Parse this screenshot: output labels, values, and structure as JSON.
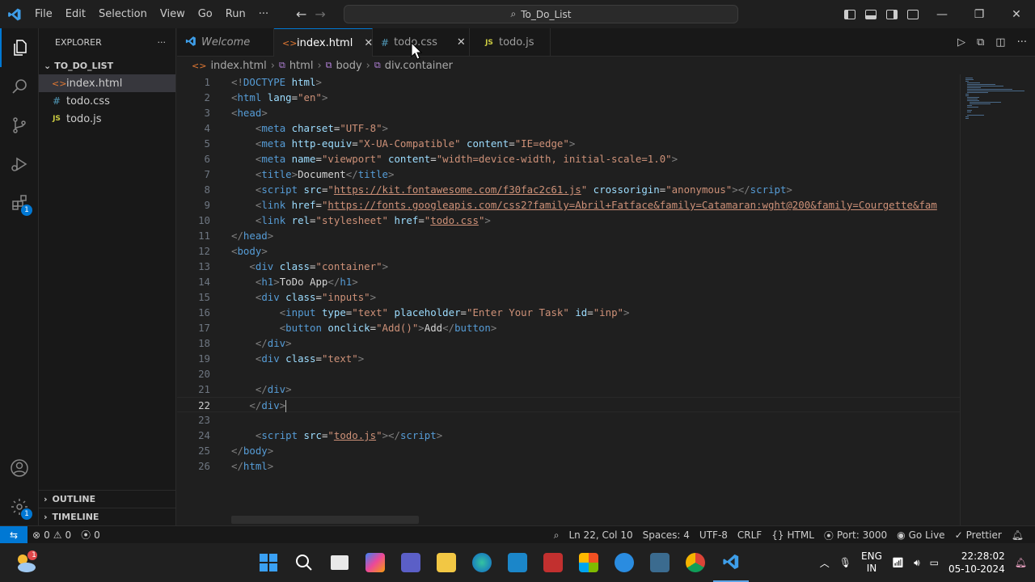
{
  "menu": [
    "File",
    "Edit",
    "Selection",
    "View",
    "Go",
    "Run",
    "···"
  ],
  "command_center": "To_Do_List",
  "explorer": {
    "title": "EXPLORER",
    "more": "···",
    "folder": "TO_DO_LIST",
    "files": [
      {
        "name": "index.html",
        "icon": "<>",
        "type": "html"
      },
      {
        "name": "todo.css",
        "icon": "#",
        "type": "css"
      },
      {
        "name": "todo.js",
        "icon": "JS",
        "type": "js"
      }
    ],
    "outline": "OUTLINE",
    "timeline": "TIMELINE"
  },
  "tabs": [
    {
      "label": "Welcome",
      "icon": "⟩"
    },
    {
      "label": "index.html",
      "icon": "<>"
    },
    {
      "label": "todo.css",
      "icon": "#"
    },
    {
      "label": "todo.js",
      "icon": "JS"
    }
  ],
  "tab_close": "✕",
  "breadcrumb": [
    "index.html",
    "html",
    "body",
    "div.container"
  ],
  "breadcrumb_icons": [
    "<>",
    "⧉",
    "⧉",
    "⧉"
  ],
  "code": {
    "line_numbers": [
      "1",
      "2",
      "3",
      "4",
      "5",
      "6",
      "7",
      "8",
      "9",
      "10",
      "11",
      "12",
      "13",
      "14",
      "15",
      "16",
      "17",
      "18",
      "19",
      "20",
      "21",
      "22",
      "23",
      "24",
      "25",
      "26"
    ],
    "lines": [
      {
        "indent": "",
        "parts": [
          [
            "g",
            "<!"
          ],
          [
            "t",
            "DOCTYPE"
          ],
          [
            "d",
            " "
          ],
          [
            "a",
            "html"
          ],
          [
            "g",
            ">"
          ]
        ]
      },
      {
        "indent": "",
        "parts": [
          [
            "g",
            "<"
          ],
          [
            "t",
            "html"
          ],
          [
            "d",
            " "
          ],
          [
            "a",
            "lang"
          ],
          [
            "d",
            "="
          ],
          [
            "s",
            "\"en\""
          ],
          [
            "g",
            ">"
          ]
        ]
      },
      {
        "indent": "",
        "parts": [
          [
            "g",
            "<"
          ],
          [
            "t",
            "head"
          ],
          [
            "g",
            ">"
          ]
        ]
      },
      {
        "indent": "    ",
        "parts": [
          [
            "g",
            "<"
          ],
          [
            "t",
            "meta"
          ],
          [
            "d",
            " "
          ],
          [
            "a",
            "charset"
          ],
          [
            "d",
            "="
          ],
          [
            "s",
            "\"UTF-8\""
          ],
          [
            "g",
            ">"
          ]
        ]
      },
      {
        "indent": "    ",
        "parts": [
          [
            "g",
            "<"
          ],
          [
            "t",
            "meta"
          ],
          [
            "d",
            " "
          ],
          [
            "a",
            "http-equiv"
          ],
          [
            "d",
            "="
          ],
          [
            "s",
            "\"X-UA-Compatible\""
          ],
          [
            "d",
            " "
          ],
          [
            "a",
            "content"
          ],
          [
            "d",
            "="
          ],
          [
            "s",
            "\"IE=edge\""
          ],
          [
            "g",
            ">"
          ]
        ]
      },
      {
        "indent": "    ",
        "parts": [
          [
            "g",
            "<"
          ],
          [
            "t",
            "meta"
          ],
          [
            "d",
            " "
          ],
          [
            "a",
            "name"
          ],
          [
            "d",
            "="
          ],
          [
            "s",
            "\"viewport\""
          ],
          [
            "d",
            " "
          ],
          [
            "a",
            "content"
          ],
          [
            "d",
            "="
          ],
          [
            "s",
            "\"width=device-width, initial-scale=1.0\""
          ],
          [
            "g",
            ">"
          ]
        ]
      },
      {
        "indent": "    ",
        "parts": [
          [
            "g",
            "<"
          ],
          [
            "t",
            "title"
          ],
          [
            "g",
            ">"
          ],
          [
            "d",
            "Document"
          ],
          [
            "g",
            "</"
          ],
          [
            "t",
            "title"
          ],
          [
            "g",
            ">"
          ]
        ]
      },
      {
        "indent": "    ",
        "parts": [
          [
            "g",
            "<"
          ],
          [
            "t",
            "script"
          ],
          [
            "d",
            " "
          ],
          [
            "a",
            "src"
          ],
          [
            "d",
            "="
          ],
          [
            "s",
            "\""
          ],
          [
            "su",
            "https://kit.fontawesome.com/f30fac2c61.js"
          ],
          [
            "s",
            "\""
          ],
          [
            "d",
            " "
          ],
          [
            "a",
            "crossorigin"
          ],
          [
            "d",
            "="
          ],
          [
            "s",
            "\"anonymous\""
          ],
          [
            "g",
            "></"
          ],
          [
            "t",
            "script"
          ],
          [
            "g",
            ">"
          ]
        ]
      },
      {
        "indent": "    ",
        "parts": [
          [
            "g",
            "<"
          ],
          [
            "t",
            "link"
          ],
          [
            "d",
            " "
          ],
          [
            "a",
            "href"
          ],
          [
            "d",
            "="
          ],
          [
            "s",
            "\""
          ],
          [
            "su",
            "https://fonts.googleapis.com/css2?family=Abril+Fatface&family=Catamaran:wght@200&family=Courgette&fam"
          ]
        ]
      },
      {
        "indent": "    ",
        "parts": [
          [
            "g",
            "<"
          ],
          [
            "t",
            "link"
          ],
          [
            "d",
            " "
          ],
          [
            "a",
            "rel"
          ],
          [
            "d",
            "="
          ],
          [
            "s",
            "\"stylesheet\""
          ],
          [
            "d",
            " "
          ],
          [
            "a",
            "href"
          ],
          [
            "d",
            "="
          ],
          [
            "s",
            "\""
          ],
          [
            "su",
            "todo.css"
          ],
          [
            "s",
            "\""
          ],
          [
            "g",
            ">"
          ]
        ]
      },
      {
        "indent": "",
        "parts": [
          [
            "g",
            "</"
          ],
          [
            "t",
            "head"
          ],
          [
            "g",
            ">"
          ]
        ]
      },
      {
        "indent": "",
        "parts": [
          [
            "g",
            "<"
          ],
          [
            "t",
            "body"
          ],
          [
            "g",
            ">"
          ]
        ]
      },
      {
        "indent": "   ",
        "parts": [
          [
            "g",
            "<"
          ],
          [
            "t",
            "div"
          ],
          [
            "d",
            " "
          ],
          [
            "a",
            "class"
          ],
          [
            "d",
            "="
          ],
          [
            "s",
            "\"container\""
          ],
          [
            "g",
            ">"
          ]
        ]
      },
      {
        "indent": "    ",
        "parts": [
          [
            "g",
            "<"
          ],
          [
            "t",
            "h1"
          ],
          [
            "g",
            ">"
          ],
          [
            "d",
            "ToDo App"
          ],
          [
            "g",
            "</"
          ],
          [
            "t",
            "h1"
          ],
          [
            "g",
            ">"
          ]
        ]
      },
      {
        "indent": "    ",
        "parts": [
          [
            "g",
            "<"
          ],
          [
            "t",
            "div"
          ],
          [
            "d",
            " "
          ],
          [
            "a",
            "class"
          ],
          [
            "d",
            "="
          ],
          [
            "s",
            "\"inputs\""
          ],
          [
            "g",
            ">"
          ]
        ]
      },
      {
        "indent": "        ",
        "parts": [
          [
            "g",
            "<"
          ],
          [
            "t",
            "input"
          ],
          [
            "d",
            " "
          ],
          [
            "a",
            "type"
          ],
          [
            "d",
            "="
          ],
          [
            "s",
            "\"text\""
          ],
          [
            "d",
            " "
          ],
          [
            "a",
            "placeholder"
          ],
          [
            "d",
            "="
          ],
          [
            "s",
            "\"Enter Your Task\""
          ],
          [
            "d",
            " "
          ],
          [
            "a",
            "id"
          ],
          [
            "d",
            "="
          ],
          [
            "s",
            "\"inp\""
          ],
          [
            "g",
            ">"
          ]
        ]
      },
      {
        "indent": "        ",
        "parts": [
          [
            "g",
            "<"
          ],
          [
            "t",
            "button"
          ],
          [
            "d",
            " "
          ],
          [
            "a",
            "onclick"
          ],
          [
            "d",
            "="
          ],
          [
            "s",
            "\"Add()\""
          ],
          [
            "g",
            ">"
          ],
          [
            "d",
            "Add"
          ],
          [
            "g",
            "</"
          ],
          [
            "t",
            "button"
          ],
          [
            "g",
            ">"
          ]
        ]
      },
      {
        "indent": "    ",
        "parts": [
          [
            "g",
            "</"
          ],
          [
            "t",
            "div"
          ],
          [
            "g",
            ">"
          ]
        ]
      },
      {
        "indent": "    ",
        "parts": [
          [
            "g",
            "<"
          ],
          [
            "t",
            "div"
          ],
          [
            "d",
            " "
          ],
          [
            "a",
            "class"
          ],
          [
            "d",
            "="
          ],
          [
            "s",
            "\"text\""
          ],
          [
            "g",
            ">"
          ]
        ]
      },
      {
        "indent": "",
        "parts": []
      },
      {
        "indent": "    ",
        "parts": [
          [
            "g",
            "</"
          ],
          [
            "t",
            "div"
          ],
          [
            "g",
            ">"
          ]
        ]
      },
      {
        "indent": "   ",
        "parts": [
          [
            "g",
            "</"
          ],
          [
            "t",
            "div"
          ],
          [
            "g",
            ">"
          ]
        ]
      },
      {
        "indent": "",
        "parts": []
      },
      {
        "indent": "    ",
        "parts": [
          [
            "g",
            "<"
          ],
          [
            "t",
            "script"
          ],
          [
            "d",
            " "
          ],
          [
            "a",
            "src"
          ],
          [
            "d",
            "="
          ],
          [
            "s",
            "\""
          ],
          [
            "su",
            "todo.js"
          ],
          [
            "s",
            "\""
          ],
          [
            "g",
            "></"
          ],
          [
            "t",
            "script"
          ],
          [
            "g",
            ">"
          ]
        ]
      },
      {
        "indent": "",
        "parts": [
          [
            "g",
            "</"
          ],
          [
            "t",
            "body"
          ],
          [
            "g",
            ">"
          ]
        ]
      },
      {
        "indent": "",
        "parts": [
          [
            "g",
            "</"
          ],
          [
            "t",
            "html"
          ],
          [
            "g",
            ">"
          ]
        ]
      }
    ],
    "current_line": 22
  },
  "status": {
    "errors": "0",
    "warnings": "0",
    "ports": "0",
    "position": "Ln 22, Col 10",
    "spaces": "Spaces: 4",
    "encoding": "UTF-8",
    "eol": "CRLF",
    "language": "HTML",
    "port": "Port: 3000",
    "golive": "Go Live",
    "prettier": "Prettier"
  },
  "taskbar": {
    "lang_top": "ENG",
    "lang_bottom": "IN",
    "time": "22:28:02",
    "date": "05-10-2024",
    "weather_badge": "1"
  },
  "badges": {
    "extensions": "1",
    "settings": "1"
  },
  "colors": {
    "accent": "#0078d4",
    "tag": "#569cd6",
    "attr": "#9cdcfe",
    "string": "#ce9178"
  }
}
